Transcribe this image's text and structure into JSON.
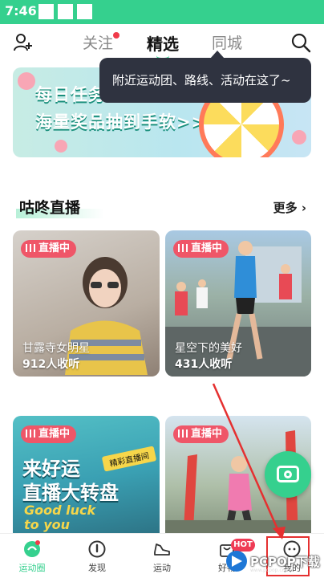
{
  "status_bar": {
    "time": "7:46"
  },
  "header": {
    "tabs": [
      {
        "label": "关注",
        "has_dot": true
      },
      {
        "label": "精选",
        "active": true
      },
      {
        "label": "同城"
      }
    ]
  },
  "banner": {
    "line1": "每日任务",
    "line2": "海量奖品抽到手软>>"
  },
  "tooltip": {
    "text": "附近运动团、路线、活动在这了~"
  },
  "live_section": {
    "title": "咕咚直播",
    "more_label": "更多",
    "cards": [
      {
        "badge": "直播中",
        "caption": "甘露寺女明星",
        "listeners": "912人收听"
      },
      {
        "badge": "直播中",
        "caption": "星空下的美好",
        "listeners": "431人收听"
      },
      {
        "badge": "直播中",
        "overlay_line1": "来好运",
        "overlay_line2": "直播大转盘",
        "overlay_line3": "Good luck",
        "overlay_line4": "to you",
        "tag": "精彩直播间"
      },
      {
        "badge": "直播中"
      }
    ]
  },
  "bottom_nav": {
    "items": [
      {
        "label": "运动圈",
        "icon": "sport-circle-icon",
        "active": true
      },
      {
        "label": "发现",
        "icon": "compass-icon"
      },
      {
        "label": "运动",
        "icon": "shoe-icon"
      },
      {
        "label": "好物",
        "icon": "shop-icon",
        "badge": "HOT"
      },
      {
        "label": "我的",
        "icon": "profile-icon"
      }
    ]
  },
  "watermark": {
    "brand": "PCPOP下载",
    "url": "www.pcpop.com"
  },
  "colors": {
    "accent": "#35d08e",
    "live_badge": "#ef5668",
    "tooltip_bg": "#2f3340",
    "annotation": "#e53030"
  }
}
